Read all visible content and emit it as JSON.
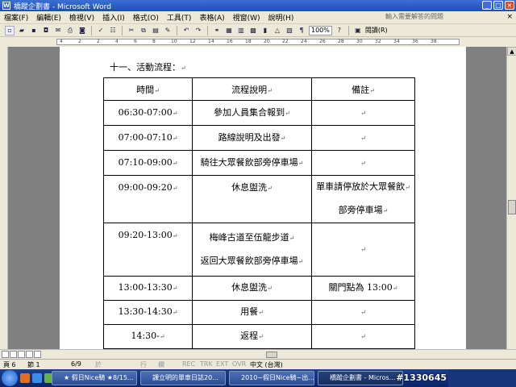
{
  "window": {
    "title": "橋蹤企劃書 - Microsoft Word",
    "app_icon": "W",
    "buttons": [
      "minimize-icon",
      "maximize-icon",
      "close-icon"
    ]
  },
  "menu": {
    "items": [
      "檔案(F)",
      "編輯(E)",
      "檢視(V)",
      "插入(I)",
      "格式(O)",
      "工具(T)",
      "表格(A)",
      "視窗(W)",
      "說明(H)"
    ],
    "help_placeholder": "輸入需要解答的問題",
    "close_glyph": "×"
  },
  "toolbar": {
    "zoom": "100%",
    "read_label": "閱讀(R)"
  },
  "ruler": {
    "labels": [
      "4",
      "2",
      "2",
      "4",
      "6",
      "8",
      "10",
      "12",
      "14",
      "16",
      "18",
      "20",
      "22",
      "24",
      "26",
      "28",
      "30",
      "32",
      "34",
      "36",
      "38"
    ]
  },
  "document": {
    "heading": "十一、活動流程：",
    "para_mark": "↵",
    "table": {
      "headers": [
        "時間",
        "流程說明",
        "備註"
      ],
      "rows": [
        {
          "time": "06:30-07:00",
          "desc": [
            "參加人員集合報到"
          ],
          "note": [
            ""
          ]
        },
        {
          "time": "07:00-07:10",
          "desc": [
            "路線說明及出發"
          ],
          "note": [
            ""
          ]
        },
        {
          "time": "07:10-09:00",
          "desc": [
            "騎往大眾餐飲部旁停車場"
          ],
          "note": [
            ""
          ]
        },
        {
          "time": "09:00-09:20",
          "desc": [
            "休息盥洗"
          ],
          "note": [
            "單車請停放於大眾餐飲",
            "部旁停車場"
          ]
        },
        {
          "time": "09:20-13:00",
          "desc": [
            "梅峰古道至伍龍步道",
            "返回大眾餐飲部旁停車場"
          ],
          "note": [
            ""
          ]
        },
        {
          "time": "13:00-13:30",
          "desc": [
            "休息盥洗"
          ],
          "note": [
            "關門點為 13:00"
          ]
        },
        {
          "time": "13:30-14:30",
          "desc": [
            "用餐"
          ],
          "note": [
            ""
          ]
        },
        {
          "time": "14:30-",
          "desc": [
            "返程"
          ],
          "note": [
            ""
          ]
        }
      ]
    }
  },
  "status": {
    "page": "頁 6",
    "section": "節 1",
    "pages": "6/9",
    "at": "於",
    "line": "行",
    "col": "欄",
    "rec": "REC",
    "trk": "TRK",
    "ext": "EXT",
    "ovr": "OVR",
    "lang": "中文 (台灣)"
  },
  "taskbar": {
    "tasks": [
      "★ 假日Nice騎 ★8/15...",
      "課立明的單車日誌20...",
      "2010~假日Nice騎~出...",
      "橋蹤企劃書 - Micros..."
    ],
    "active_task": 3,
    "watermark": "#1330645"
  }
}
